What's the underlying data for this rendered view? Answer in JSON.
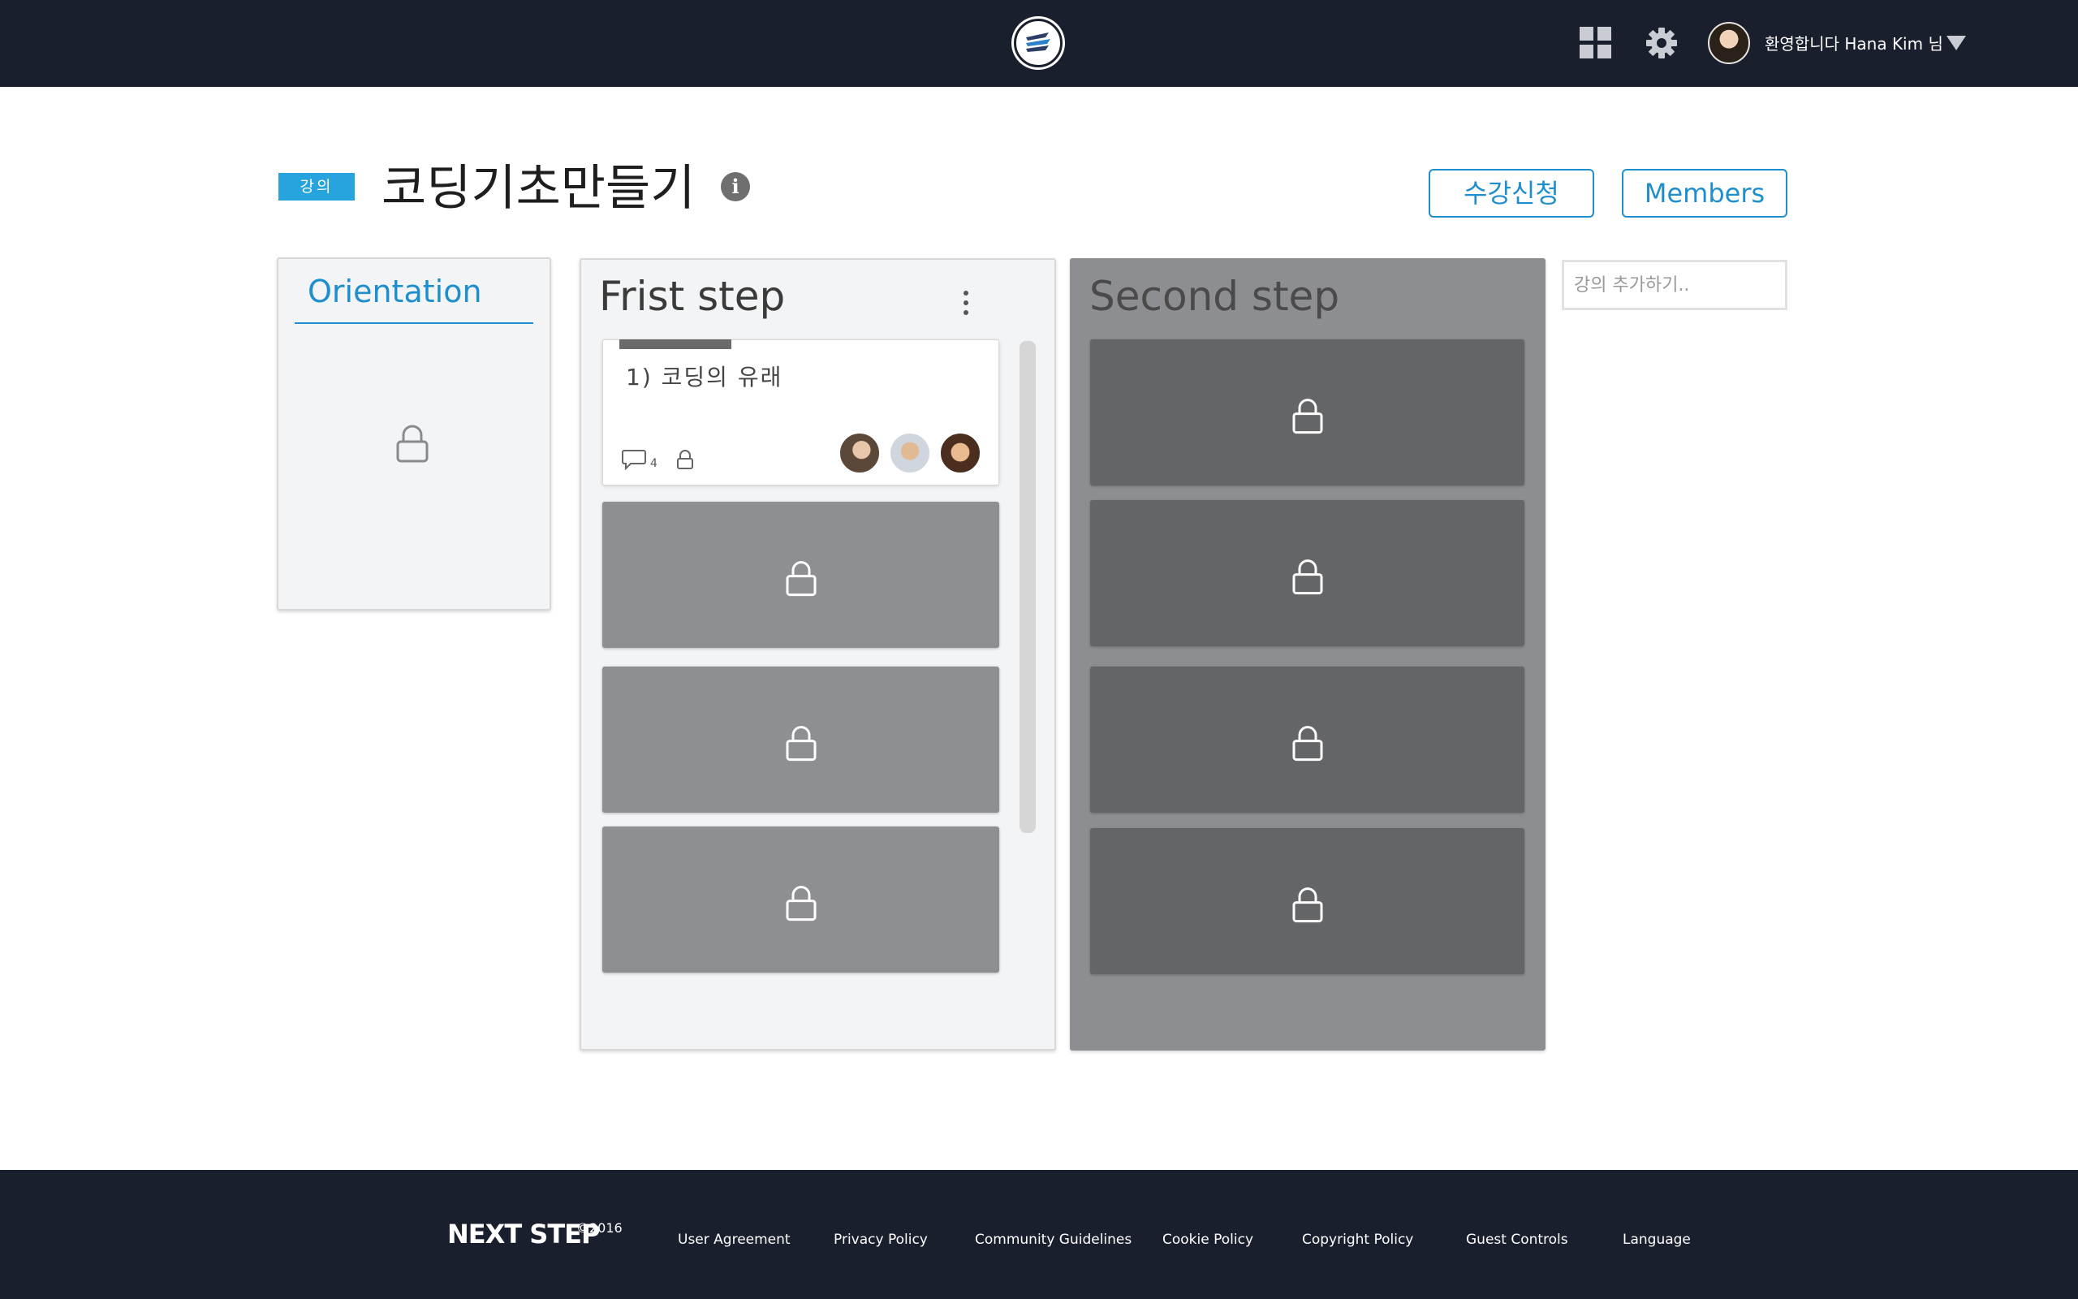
{
  "header": {
    "greeting": "환영합니다 Hana Kim 님",
    "icons": [
      "logo-icon",
      "apps-grid-icon",
      "gear-icon",
      "user-avatar",
      "caret-down-icon"
    ],
    "colors": {
      "background": "#1a1f2e",
      "icon": "#c9ccd2"
    }
  },
  "course": {
    "badge": "강의",
    "title": "코딩기초만들기",
    "info_icon": "i",
    "enroll_label": "수강신청",
    "members_label": "Members",
    "accent": "#1e8fcc"
  },
  "columns": {
    "orientation": {
      "title": "Orientation",
      "state": "locked"
    },
    "first": {
      "title": "Frist step",
      "cards": [
        {
          "title": "1) 코딩의 유래",
          "comment_count": "4",
          "state": "open",
          "member_avatars": 3
        },
        {
          "state": "locked"
        },
        {
          "state": "locked"
        },
        {
          "state": "locked"
        }
      ]
    },
    "second": {
      "title": "Second step",
      "cards": [
        {
          "state": "locked"
        },
        {
          "state": "locked"
        },
        {
          "state": "locked"
        },
        {
          "state": "locked"
        }
      ]
    }
  },
  "add_lecture": {
    "placeholder": "강의 추가하기.."
  },
  "footer": {
    "brand": "NEXT STEP",
    "copyright": "©2016",
    "links": [
      "User Agreement",
      "Privacy Policy",
      "Community Guidelines",
      "Cookie Policy",
      "Copyright Policy",
      "Guest Controls",
      "Language"
    ]
  }
}
